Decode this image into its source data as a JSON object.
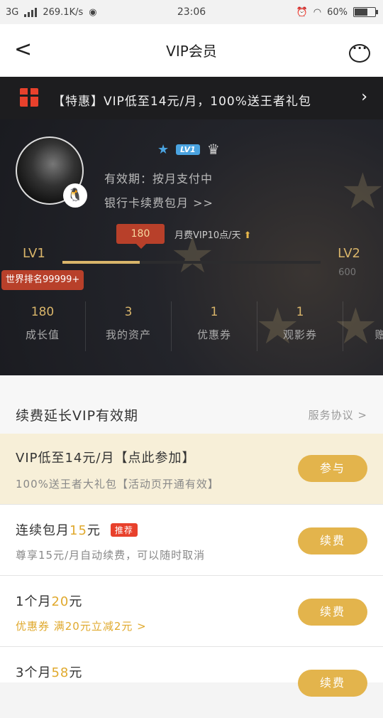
{
  "statusbar": {
    "carrier": "3G",
    "speed": "269.1K/s",
    "time": "23:06",
    "battery": "60%"
  },
  "nav": {
    "back": "<",
    "title": "VIP会员"
  },
  "promo": {
    "text": "【特惠】VIP低至14元/月，100%送王者礼包"
  },
  "profile": {
    "level_badge": "LV1",
    "validity": "有效期：按月支付中",
    "bank_link": "银行卡续费包月 >>",
    "points": "180",
    "monthly_gain": "月费VIP10点/天",
    "level_from": "LV1",
    "level_to": "LV2",
    "level_to_value": "600",
    "progress_percent": 30,
    "rank_tag": "世界排名99999+"
  },
  "stats": [
    {
      "value": "180",
      "label": "成长值"
    },
    {
      "value": "3",
      "label": "我的资产"
    },
    {
      "value": "1",
      "label": "优惠券"
    },
    {
      "value": "1",
      "label": "观影券"
    },
    {
      "value": "",
      "label": "赠片"
    }
  ],
  "renew": {
    "title": "续费延长VIP有效期",
    "agreement": "服务协议 >",
    "items": [
      {
        "title": "VIP低至14元/月【点此参加】",
        "sub": "100%送王者大礼包【活动页开通有效】",
        "button": "参与"
      },
      {
        "title_prefix": "连续包月",
        "title_price": "15",
        "title_suffix": "元",
        "tag": "推荐",
        "sub": "尊享15元/月自动续费，可以随时取消",
        "button": "续费"
      },
      {
        "title_prefix": "1个月",
        "title_price": "20",
        "title_suffix": "元",
        "sub": "优惠券 满20元立减2元 >",
        "button": "续费"
      },
      {
        "title_prefix": "3个月",
        "title_price": "58",
        "title_suffix": "元",
        "button": "续费"
      }
    ]
  },
  "colors": {
    "accent": "#e3b44c",
    "promo_red": "#e8412c",
    "hero_bg": "#1d1e24"
  }
}
